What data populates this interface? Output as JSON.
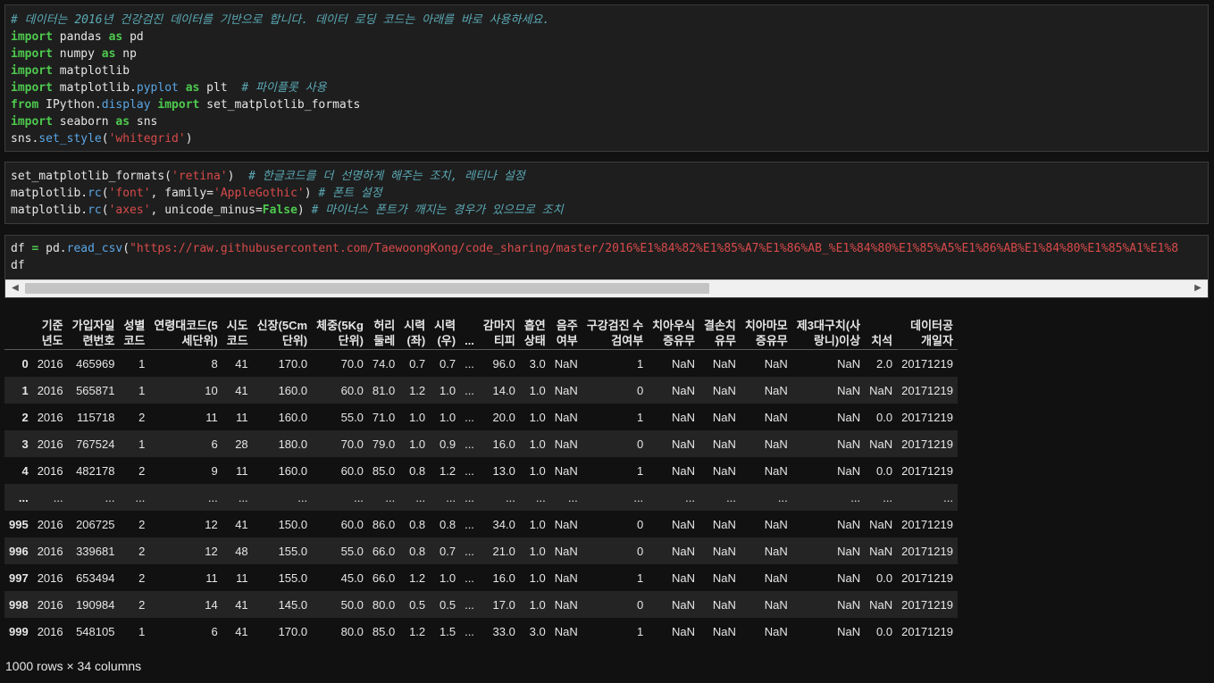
{
  "cells": {
    "c1_lines": [
      [
        [
          "cm",
          "# 데이터는 2016년 건강검진 데이터를 기반으로 합니다. 데이터 로딩 코드는 아래를 바로 사용하세요."
        ]
      ],
      [
        [
          "kw",
          "import"
        ],
        [
          "t",
          " pandas "
        ],
        [
          "kw",
          "as"
        ],
        [
          "t",
          " pd"
        ]
      ],
      [
        [
          "kw",
          "import"
        ],
        [
          "t",
          " numpy "
        ],
        [
          "kw",
          "as"
        ],
        [
          "t",
          " np"
        ]
      ],
      [
        [
          "kw",
          "import"
        ],
        [
          "t",
          " matplotlib"
        ]
      ],
      [
        [
          "kw",
          "import"
        ],
        [
          "t",
          " matplotlib."
        ],
        [
          "fn",
          "pyplot"
        ],
        [
          "t",
          " "
        ],
        [
          "kw",
          "as"
        ],
        [
          "t",
          " plt  "
        ],
        [
          "cm",
          "# 파이플롯 사용"
        ]
      ],
      [
        [
          "kw",
          "from"
        ],
        [
          "t",
          " IPython."
        ],
        [
          "fn",
          "display"
        ],
        [
          "t",
          " "
        ],
        [
          "kw",
          "import"
        ],
        [
          "t",
          " set_matplotlib_formats"
        ]
      ],
      [
        [
          "kw",
          "import"
        ],
        [
          "t",
          " seaborn "
        ],
        [
          "kw",
          "as"
        ],
        [
          "t",
          " sns"
        ]
      ],
      [
        [
          "t",
          "sns."
        ],
        [
          "fn",
          "set_style"
        ],
        [
          "t",
          "("
        ],
        [
          "st",
          "'whitegrid'"
        ],
        [
          "t",
          ")"
        ]
      ]
    ],
    "c2_lines": [
      [
        [
          "t",
          "set_matplotlib_formats("
        ],
        [
          "st",
          "'retina'"
        ],
        [
          "t",
          ")  "
        ],
        [
          "cm",
          "# 한글코드를 더 선명하게 해주는 조치, 레티나 설정"
        ]
      ],
      [
        [
          "t",
          "matplotlib."
        ],
        [
          "fn",
          "rc"
        ],
        [
          "t",
          "("
        ],
        [
          "st",
          "'font'"
        ],
        [
          "t",
          ", family="
        ],
        [
          "st",
          "'AppleGothic'"
        ],
        [
          "t",
          ") "
        ],
        [
          "cm",
          "# 폰트 설정"
        ]
      ],
      [
        [
          "t",
          "matplotlib."
        ],
        [
          "fn",
          "rc"
        ],
        [
          "t",
          "("
        ],
        [
          "st",
          "'axes'"
        ],
        [
          "t",
          ", unicode_minus="
        ],
        [
          "bl",
          "False"
        ],
        [
          "t",
          ") "
        ],
        [
          "cm",
          "# 마이너스 폰트가 깨지는 경우가 있으므로 조치"
        ]
      ]
    ],
    "c3_lines": [
      [
        [
          "t",
          "df "
        ],
        [
          "bl",
          "="
        ],
        [
          "t",
          " pd."
        ],
        [
          "fn",
          "read_csv"
        ],
        [
          "t",
          "("
        ],
        [
          "st",
          "\"https://raw.githubusercontent.com/TaewoongKong/code_sharing/master/2016%E1%84%82%E1%85%A7%E1%86%AB_%E1%84%80%E1%85%A5%E1%86%AB%E1%84%80%E1%85%A1%E1%8"
        ]
      ],
      [
        [
          "t",
          "df"
        ]
      ]
    ]
  },
  "table": {
    "headers": [
      [
        "",
        ""
      ],
      [
        "기준",
        "년도"
      ],
      [
        "가입자일",
        "련번호"
      ],
      [
        "성별",
        "코드"
      ],
      [
        "연령대코드(5",
        "세단위)"
      ],
      [
        "시도",
        "코드"
      ],
      [
        "신장(5Cm",
        "단위)"
      ],
      [
        "체중(5Kg",
        "단위)"
      ],
      [
        "허리",
        "둘레"
      ],
      [
        "시력",
        "(좌)"
      ],
      [
        "시력",
        "(우)"
      ],
      [
        "",
        "..."
      ],
      [
        "감마지",
        "티피"
      ],
      [
        "흡연",
        "상태"
      ],
      [
        "음주",
        "여부"
      ],
      [
        "구강검진 수",
        "검여부"
      ],
      [
        "치아우식",
        "증유무"
      ],
      [
        "결손치",
        "유무"
      ],
      [
        "치아마모",
        "증유무"
      ],
      [
        "제3대구치(사",
        "랑니)이상"
      ],
      [
        "",
        "치석"
      ],
      [
        "데이터공",
        "개일자"
      ]
    ],
    "rows": [
      [
        "0",
        "2016",
        "465969",
        "1",
        "8",
        "41",
        "170.0",
        "70.0",
        "74.0",
        "0.7",
        "0.7",
        "...",
        "96.0",
        "3.0",
        "NaN",
        "1",
        "NaN",
        "NaN",
        "NaN",
        "NaN",
        "2.0",
        "20171219"
      ],
      [
        "1",
        "2016",
        "565871",
        "1",
        "10",
        "41",
        "160.0",
        "60.0",
        "81.0",
        "1.2",
        "1.0",
        "...",
        "14.0",
        "1.0",
        "NaN",
        "0",
        "NaN",
        "NaN",
        "NaN",
        "NaN",
        "NaN",
        "20171219"
      ],
      [
        "2",
        "2016",
        "115718",
        "2",
        "11",
        "11",
        "160.0",
        "55.0",
        "71.0",
        "1.0",
        "1.0",
        "...",
        "20.0",
        "1.0",
        "NaN",
        "1",
        "NaN",
        "NaN",
        "NaN",
        "NaN",
        "0.0",
        "20171219"
      ],
      [
        "3",
        "2016",
        "767524",
        "1",
        "6",
        "28",
        "180.0",
        "70.0",
        "79.0",
        "1.0",
        "0.9",
        "...",
        "16.0",
        "1.0",
        "NaN",
        "0",
        "NaN",
        "NaN",
        "NaN",
        "NaN",
        "NaN",
        "20171219"
      ],
      [
        "4",
        "2016",
        "482178",
        "2",
        "9",
        "11",
        "160.0",
        "60.0",
        "85.0",
        "0.8",
        "1.2",
        "...",
        "13.0",
        "1.0",
        "NaN",
        "1",
        "NaN",
        "NaN",
        "NaN",
        "NaN",
        "0.0",
        "20171219"
      ],
      [
        "...",
        "...",
        "...",
        "...",
        "...",
        "...",
        "...",
        "...",
        "...",
        "...",
        "...",
        "...",
        "...",
        "...",
        "...",
        "...",
        "...",
        "...",
        "...",
        "...",
        "...",
        "..."
      ],
      [
        "995",
        "2016",
        "206725",
        "2",
        "12",
        "41",
        "150.0",
        "60.0",
        "86.0",
        "0.8",
        "0.8",
        "...",
        "34.0",
        "1.0",
        "NaN",
        "0",
        "NaN",
        "NaN",
        "NaN",
        "NaN",
        "NaN",
        "20171219"
      ],
      [
        "996",
        "2016",
        "339681",
        "2",
        "12",
        "48",
        "155.0",
        "55.0",
        "66.0",
        "0.8",
        "0.7",
        "...",
        "21.0",
        "1.0",
        "NaN",
        "0",
        "NaN",
        "NaN",
        "NaN",
        "NaN",
        "NaN",
        "20171219"
      ],
      [
        "997",
        "2016",
        "653494",
        "2",
        "11",
        "11",
        "155.0",
        "45.0",
        "66.0",
        "1.2",
        "1.0",
        "...",
        "16.0",
        "1.0",
        "NaN",
        "1",
        "NaN",
        "NaN",
        "NaN",
        "NaN",
        "0.0",
        "20171219"
      ],
      [
        "998",
        "2016",
        "190984",
        "2",
        "14",
        "41",
        "145.0",
        "50.0",
        "80.0",
        "0.5",
        "0.5",
        "...",
        "17.0",
        "1.0",
        "NaN",
        "0",
        "NaN",
        "NaN",
        "NaN",
        "NaN",
        "NaN",
        "20171219"
      ],
      [
        "999",
        "2016",
        "548105",
        "1",
        "6",
        "41",
        "170.0",
        "80.0",
        "85.0",
        "1.2",
        "1.5",
        "...",
        "33.0",
        "3.0",
        "NaN",
        "1",
        "NaN",
        "NaN",
        "NaN",
        "NaN",
        "0.0",
        "20171219"
      ]
    ],
    "shape_text": "1000 rows × 34 columns"
  }
}
